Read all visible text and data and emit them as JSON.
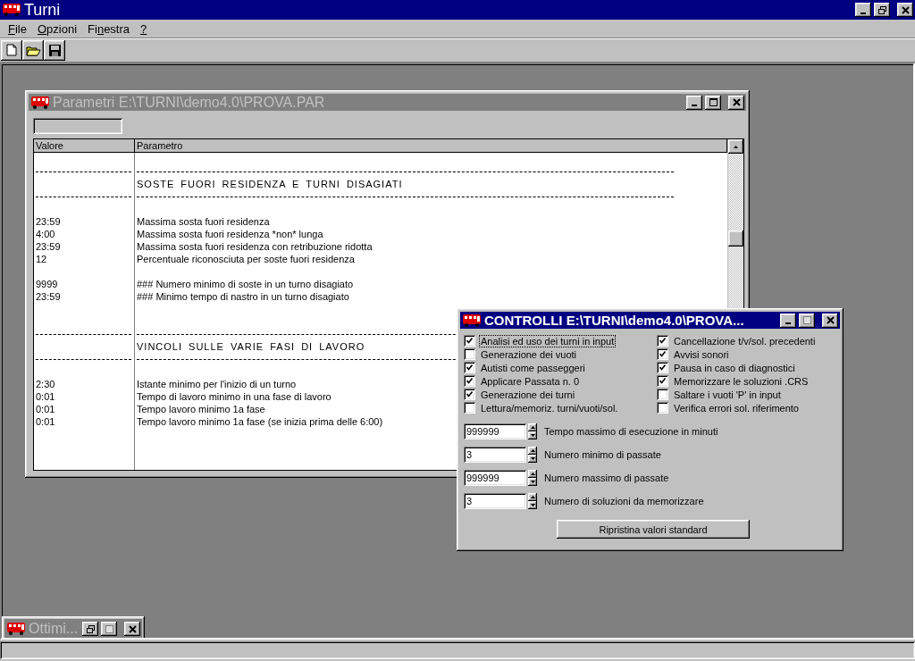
{
  "window": {
    "title": "Turni"
  },
  "menu": [
    {
      "key": "F",
      "after": "ile"
    },
    {
      "key": "O",
      "after": "pzioni"
    },
    {
      "before": "Fi",
      "key": "n",
      "after": "estra"
    },
    {
      "key": "?"
    }
  ],
  "parametri_window": {
    "title": "Parametri E:\\TURNI\\demo4.0\\PROVA.PAR",
    "active": false,
    "columns": [
      "Valore",
      "Parametro"
    ],
    "rows": [
      {
        "kind": "blank"
      },
      {
        "kind": "separator"
      },
      {
        "kind": "heading",
        "parametro": "SOSTE FUORI RESIDENZA E TURNI DISAGIATI"
      },
      {
        "kind": "separator"
      },
      {
        "kind": "blank"
      },
      {
        "kind": "value",
        "valore": "23:59",
        "parametro": "Massima sosta fuori residenza"
      },
      {
        "kind": "value",
        "valore": "4:00",
        "parametro": "Massima sosta fuori residenza *non* lunga"
      },
      {
        "kind": "value",
        "valore": "23:59",
        "parametro": "Massima sosta fuori residenza con retribuzione ridotta"
      },
      {
        "kind": "value",
        "valore": "12",
        "parametro": "Percentuale riconosciuta per soste fuori residenza"
      },
      {
        "kind": "blank"
      },
      {
        "kind": "value",
        "valore": "9999",
        "parametro": "### Numero minimo di soste in un turno disagiato"
      },
      {
        "kind": "value",
        "valore": "23:59",
        "parametro": "### Minimo tempo di nastro in un turno disagiato"
      },
      {
        "kind": "blank"
      },
      {
        "kind": "blank"
      },
      {
        "kind": "separator"
      },
      {
        "kind": "heading",
        "parametro": "VINCOLI SULLE VARIE FASI DI LAVORO"
      },
      {
        "kind": "separator"
      },
      {
        "kind": "blank"
      },
      {
        "kind": "value",
        "valore": "2:30",
        "parametro": "Istante minimo per l'inizio di un turno"
      },
      {
        "kind": "value",
        "valore": "0:01",
        "parametro": "Tempo di lavoro minimo in una fase di lavoro"
      },
      {
        "kind": "value",
        "valore": "0:01",
        "parametro": "Tempo lavoro minimo 1a fase"
      },
      {
        "kind": "value",
        "valore": "0:01",
        "parametro": "Tempo lavoro minimo 1a fase (se inizia prima delle 6:00)"
      }
    ]
  },
  "controlli_window": {
    "title": "CONTROLLI E:\\TURNI\\demo4.0\\PROVA...",
    "active": true,
    "checkboxes": [
      {
        "label": "Analisi ed uso dei turni in input",
        "checked": true,
        "focused": true
      },
      {
        "label": "Cancellazione t/v/sol. precedenti",
        "checked": true,
        "focused": false
      },
      {
        "label": "Generazione dei vuoti",
        "checked": false,
        "focused": false
      },
      {
        "label": "Avvisi sonori",
        "checked": true,
        "focused": false
      },
      {
        "label": "Autisti come passeggeri",
        "checked": true,
        "focused": false
      },
      {
        "label": "Pausa in caso di diagnostici",
        "checked": true,
        "focused": false
      },
      {
        "label": "Applicare Passata n. 0",
        "checked": true,
        "focused": false
      },
      {
        "label": "Memorizzare le soluzioni .CRS",
        "checked": true,
        "focused": false
      },
      {
        "label": "Generazione dei turni",
        "checked": true,
        "focused": false
      },
      {
        "label": "Saltare i vuoti 'P' in input",
        "checked": false,
        "focused": false
      },
      {
        "label": "Lettura/memoriz. turni/vuoti/sol.",
        "checked": false,
        "focused": false
      },
      {
        "label": "Verifica errori sol. riferimento",
        "checked": false,
        "focused": false
      }
    ],
    "spinners": [
      {
        "value": "999999",
        "label": "Tempo massimo di esecuzione in minuti"
      },
      {
        "value": "3",
        "label": "Numero minimo  di passate"
      },
      {
        "value": "999999",
        "label": "Numero massimo di passate"
      },
      {
        "value": "3",
        "label": "Numero di soluzioni da memorizzare"
      }
    ],
    "button": "Ripristina valori standard"
  },
  "minimized_window": {
    "title": "Ottimi...",
    "active": false
  }
}
